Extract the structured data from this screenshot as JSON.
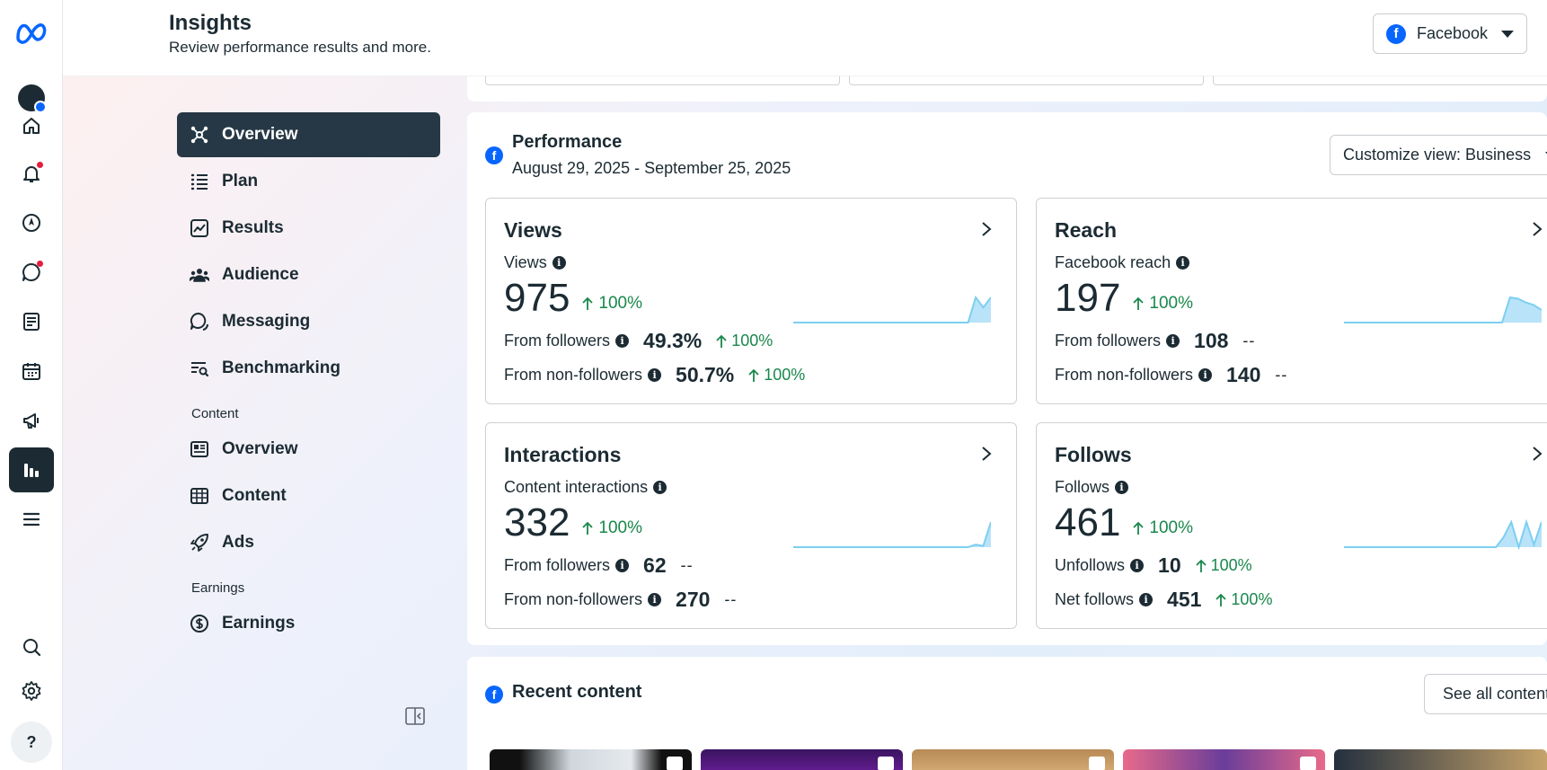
{
  "header": {
    "title": "Insights",
    "subtitle": "Review performance results and more.",
    "platform_select": {
      "label": "Facebook",
      "icon": "facebook-icon"
    }
  },
  "rail": {
    "items": [
      {
        "name": "home",
        "icon": "home-icon"
      },
      {
        "name": "notifications",
        "icon": "bell-icon",
        "badge": true
      },
      {
        "name": "compass",
        "icon": "compass-icon"
      },
      {
        "name": "inbox",
        "icon": "chat-icon",
        "badge": true
      },
      {
        "name": "posts",
        "icon": "content-icon"
      },
      {
        "name": "calendar",
        "icon": "calendar-icon"
      },
      {
        "name": "ads",
        "icon": "megaphone-icon"
      },
      {
        "name": "insights",
        "icon": "bar-chart-icon",
        "active": true
      },
      {
        "name": "all-tools",
        "icon": "menu-icon"
      }
    ],
    "bottom": [
      {
        "name": "search",
        "icon": "search-icon"
      },
      {
        "name": "settings",
        "icon": "gear-icon"
      }
    ],
    "help_label": "?"
  },
  "nav": {
    "items": [
      {
        "label": "Overview",
        "icon": "overview-icon",
        "active": true
      },
      {
        "label": "Plan",
        "icon": "list-icon"
      },
      {
        "label": "Results",
        "icon": "trend-icon"
      },
      {
        "label": "Audience",
        "icon": "people-icon"
      },
      {
        "label": "Messaging",
        "icon": "chat-icon"
      },
      {
        "label": "Benchmarking",
        "icon": "benchmark-icon"
      }
    ],
    "content_group": "Content",
    "content_items": [
      {
        "label": "Overview",
        "icon": "newspaper-icon"
      },
      {
        "label": "Content",
        "icon": "grid-icon"
      },
      {
        "label": "Ads",
        "icon": "rocket-icon"
      }
    ],
    "earnings_group": "Earnings",
    "earnings_items": [
      {
        "label": "Earnings",
        "icon": "dollar-icon"
      }
    ]
  },
  "performance": {
    "title": "Performance",
    "date_range": "August 29, 2025 - September 25, 2025",
    "customize_label": "Customize view: Business",
    "cards": [
      {
        "title": "Views",
        "metric_label": "Views",
        "value": "975",
        "change": "100%",
        "rows": [
          {
            "label": "From followers",
            "value": "49.3%",
            "change": "100%"
          },
          {
            "label": "From non-followers",
            "value": "50.7%",
            "change": "100%"
          }
        ],
        "spark": [
          0,
          0,
          0,
          0,
          0,
          0,
          0,
          0,
          0,
          0,
          0,
          0,
          0,
          0,
          0,
          0,
          0,
          0,
          0,
          0,
          0,
          0,
          0,
          0,
          1,
          0.6,
          1
        ]
      },
      {
        "title": "Reach",
        "metric_label": "Facebook reach",
        "value": "197",
        "change": "100%",
        "rows": [
          {
            "label": "From followers",
            "value": "108",
            "change": "--"
          },
          {
            "label": "From non-followers",
            "value": "140",
            "change": "--"
          }
        ],
        "spark": [
          0,
          0,
          0,
          0,
          0,
          0,
          0,
          0,
          0,
          0,
          0,
          0,
          0,
          0,
          0,
          0,
          0,
          0,
          0,
          0,
          0,
          1,
          0.95,
          0.8,
          0.7,
          0.5
        ]
      },
      {
        "title": "Interactions",
        "metric_label": "Content interactions",
        "value": "332",
        "change": "100%",
        "rows": [
          {
            "label": "From followers",
            "value": "62",
            "change": "--"
          },
          {
            "label": "From non-followers",
            "value": "270",
            "change": "--"
          }
        ],
        "spark": [
          0,
          0,
          0,
          0,
          0,
          0,
          0,
          0,
          0,
          0,
          0,
          0,
          0,
          0,
          0,
          0,
          0,
          0,
          0,
          0,
          0,
          0,
          0,
          0,
          0.1,
          0.05,
          1
        ]
      },
      {
        "title": "Follows",
        "metric_label": "Follows",
        "value": "461",
        "change": "100%",
        "rows": [
          {
            "label": "Unfollows",
            "value": "10",
            "change": "100%"
          },
          {
            "label": "Net follows",
            "value": "451",
            "change": "100%"
          }
        ],
        "spark": [
          0,
          0,
          0,
          0,
          0,
          0,
          0,
          0,
          0,
          0,
          0,
          0,
          0,
          0,
          0,
          0,
          0,
          0,
          0,
          0,
          0,
          0.4,
          1,
          0,
          1,
          0.1,
          1
        ]
      }
    ]
  },
  "recent_content": {
    "title": "Recent content",
    "see_all_label": "See all content"
  },
  "colors": {
    "primary_dark": "#1c2b33",
    "active_nav": "#263845",
    "positive": "#19874b",
    "facebook_blue": "#0866ff",
    "spark_line": "#7ccff1",
    "spark_fill": "#b9e3f8"
  }
}
